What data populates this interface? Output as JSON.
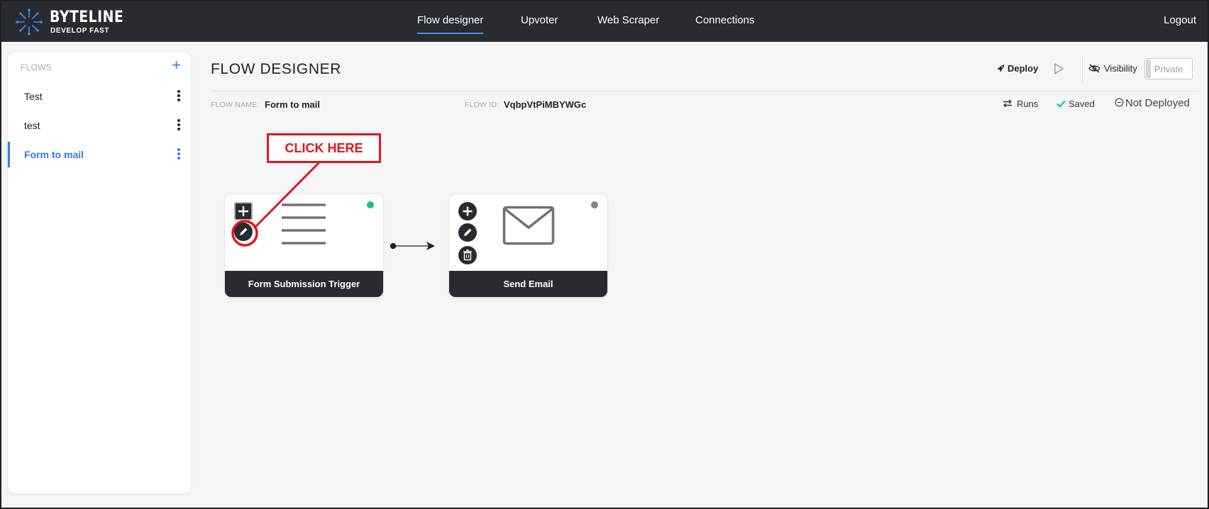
{
  "header": {
    "logo_name": "BYTELINE",
    "logo_tagline": "DEVELOP FAST",
    "nav": [
      "Flow designer",
      "Upvoter",
      "Web Scraper",
      "Connections"
    ],
    "active_nav": "Flow designer",
    "logout": "Logout"
  },
  "sidebar": {
    "heading": "FLOWS",
    "add": "+",
    "items": [
      {
        "label": "Test",
        "active": false
      },
      {
        "label": "test",
        "active": false
      },
      {
        "label": "Form to mail",
        "active": true
      }
    ]
  },
  "main": {
    "title": "FLOW DESIGNER",
    "deploy": "Deploy",
    "visibility": "Visibility",
    "visibility_value": "Private",
    "flow_name_label": "FLOW NAME:",
    "flow_name": "Form to mail",
    "flow_id_label": "FLOW ID:",
    "flow_id": "VqbpVtPiMBYWGc",
    "runs": "Runs",
    "saved": "Saved",
    "deploy_status": "Not Deployed"
  },
  "nodes": [
    {
      "title": "Form Submission Trigger",
      "icon": "form-lines-icon",
      "status_color": "#17c38a",
      "buttons": [
        "add",
        "edit"
      ]
    },
    {
      "title": "Send Email",
      "icon": "envelope-icon",
      "status_color": "#808387",
      "buttons": [
        "add",
        "edit",
        "delete"
      ]
    }
  ],
  "annotation": {
    "text": "CLICK HERE",
    "color": "#e1161f"
  },
  "colors": {
    "nav_bg": "#282b30",
    "accent": "#2f7bee",
    "success": "#17c38a"
  }
}
